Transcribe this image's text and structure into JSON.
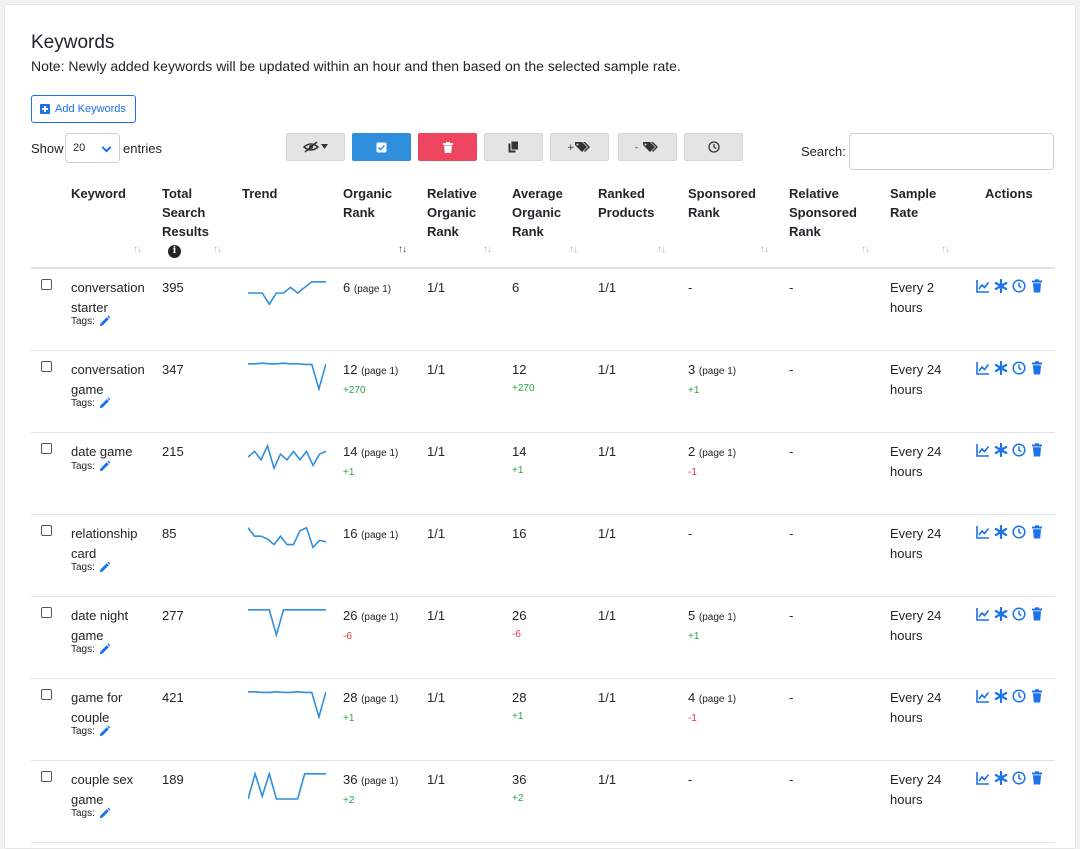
{
  "page": {
    "title": "Keywords",
    "note": "Note: Newly added keywords will be updated within an hour and then based on the selected sample rate.",
    "add_button": "Add Keywords"
  },
  "controls": {
    "show_label": "Show",
    "entries_value": "20",
    "entries_label": "entries",
    "search_label": "Search:",
    "search_value": "",
    "toolbar": [
      {
        "name": "column-visibility",
        "icon": "eye-slash-icon"
      },
      {
        "name": "select-all",
        "icon": "check-square-icon"
      },
      {
        "name": "delete",
        "icon": "trash-icon"
      },
      {
        "name": "copy",
        "icon": "copy-icon"
      },
      {
        "name": "add-tags",
        "icon": "tags-plus-icon"
      },
      {
        "name": "remove-tags",
        "icon": "tags-minus-icon"
      },
      {
        "name": "schedule",
        "icon": "clock-icon"
      }
    ],
    "colors": {
      "accent": "#1a73e8",
      "select_btn": "#2f8fdc",
      "delete_btn": "#ee4660",
      "positive": "#28a745",
      "negative": "#dc3545"
    }
  },
  "table": {
    "columns": {
      "keyword": "Keyword",
      "total1": "Total",
      "total2": "Search",
      "total3": "Results",
      "trend": "Trend",
      "organic1": "Organic",
      "organic2": "Rank",
      "rel_org1": "Relative",
      "rel_org2": "Organic",
      "rel_org3": "Rank",
      "avg1": "Average",
      "avg2": "Organic",
      "avg3": "Rank",
      "ranked1": "Ranked",
      "ranked2": "Products",
      "spons1": "Sponsored",
      "spons2": "Rank",
      "rel_sp1": "Relative",
      "rel_sp2": "Sponsored",
      "rel_sp3": "Rank",
      "rate1": "Sample",
      "rate2": "Rate",
      "actions": "Actions"
    },
    "sort_glyph": "↑↓",
    "sort_active": "↑↓",
    "tags_label": "Tags:",
    "rows": [
      {
        "kw1": "conversation",
        "kw2": "starter",
        "total": "395",
        "trend": [
          0.5,
          0.5,
          0.5,
          0.9,
          0.5,
          0.5,
          0.3,
          0.5,
          0.3,
          0.1,
          0.1,
          0.1
        ],
        "org": "6",
        "org_page": "(page 1)",
        "org_delta": "",
        "org_sign": "",
        "rel_org": "1/1",
        "avg": "6",
        "avg_delta": "",
        "ranked": "1/1",
        "sp": "-",
        "sp_page": "",
        "sp_delta": "",
        "sp_sign": "",
        "rel_sp": "-",
        "rate1": "Every 2",
        "rate2": "hours"
      },
      {
        "kw1": "conversation",
        "kw2": "game",
        "total": "347",
        "trend": [
          0.1,
          0.1,
          0.08,
          0.1,
          0.1,
          0.08,
          0.1,
          0.1,
          0.12,
          0.12,
          1.0,
          0.1
        ],
        "org": "12",
        "org_page": "(page 1)",
        "org_delta": "+270",
        "org_sign": "pos",
        "rel_org": "1/1",
        "avg": "12",
        "avg_delta": "+270",
        "ranked": "1/1",
        "sp": "3",
        "sp_page": "(page 1)",
        "sp_delta": "+1",
        "sp_sign": "pos",
        "rel_sp": "-",
        "rate1": "Every 24",
        "rate2": "hours"
      },
      {
        "kw1": "date game",
        "kw2": "",
        "total": "215",
        "trend": [
          0.5,
          0.3,
          0.6,
          0.1,
          0.9,
          0.4,
          0.6,
          0.3,
          0.6,
          0.3,
          0.8,
          0.4,
          0.3
        ],
        "org": "14",
        "org_page": "(page 1)",
        "org_delta": "+1",
        "org_sign": "pos",
        "rel_org": "1/1",
        "avg": "14",
        "avg_delta": "+1",
        "ranked": "1/1",
        "sp": "2",
        "sp_page": "(page 1)",
        "sp_delta": "-1",
        "sp_sign": "neg",
        "rel_sp": "-",
        "rate1": "Every 24",
        "rate2": "hours"
      },
      {
        "kw1": "relationship",
        "kw2": "card",
        "total": "85",
        "trend": [
          0.1,
          0.4,
          0.4,
          0.5,
          0.7,
          0.4,
          0.7,
          0.7,
          0.2,
          0.1,
          0.8,
          0.55,
          0.6
        ],
        "org": "16",
        "org_page": "(page 1)",
        "org_delta": "",
        "org_sign": "",
        "rel_org": "1/1",
        "avg": "16",
        "avg_delta": "",
        "ranked": "1/1",
        "sp": "-",
        "sp_page": "",
        "sp_delta": "",
        "sp_sign": "",
        "rel_sp": "-",
        "rate1": "Every 24",
        "rate2": "hours"
      },
      {
        "kw1": "date night",
        "kw2": "game",
        "total": "277",
        "trend": [
          0.1,
          0.1,
          0.1,
          0.1,
          1.0,
          0.1,
          0.1,
          0.1,
          0.1,
          0.1,
          0.1,
          0.1
        ],
        "org": "26",
        "org_page": "(page 1)",
        "org_delta": "-6",
        "org_sign": "neg",
        "rel_org": "1/1",
        "avg": "26",
        "avg_delta": "-6",
        "ranked": "1/1",
        "sp": "5",
        "sp_page": "(page 1)",
        "sp_delta": "+1",
        "sp_sign": "pos",
        "rel_sp": "-",
        "rate1": "Every 24",
        "rate2": "hours"
      },
      {
        "kw1": "game for",
        "kw2": "couple",
        "total": "421",
        "trend": [
          0.1,
          0.1,
          0.12,
          0.12,
          0.1,
          0.12,
          0.12,
          0.1,
          0.12,
          0.12,
          1.0,
          0.1
        ],
        "org": "28",
        "org_page": "(page 1)",
        "org_delta": "+1",
        "org_sign": "pos",
        "rel_org": "1/1",
        "avg": "28",
        "avg_delta": "+1",
        "ranked": "1/1",
        "sp": "4",
        "sp_page": "(page 1)",
        "sp_delta": "-1",
        "sp_sign": "neg",
        "rel_sp": "-",
        "rate1": "Every 24",
        "rate2": "hours"
      },
      {
        "kw1": "couple sex",
        "kw2": "game",
        "total": "189",
        "trend": [
          1.0,
          0.1,
          0.9,
          0.1,
          1.0,
          1.0,
          1.0,
          1.0,
          0.1,
          0.1,
          0.1,
          0.1
        ],
        "org": "36",
        "org_page": "(page 1)",
        "org_delta": "+2",
        "org_sign": "pos",
        "rel_org": "1/1",
        "avg": "36",
        "avg_delta": "+2",
        "ranked": "1/1",
        "sp": "-",
        "sp_page": "",
        "sp_delta": "",
        "sp_sign": "",
        "rel_sp": "-",
        "rate1": "Every 24",
        "rate2": "hours"
      }
    ]
  }
}
